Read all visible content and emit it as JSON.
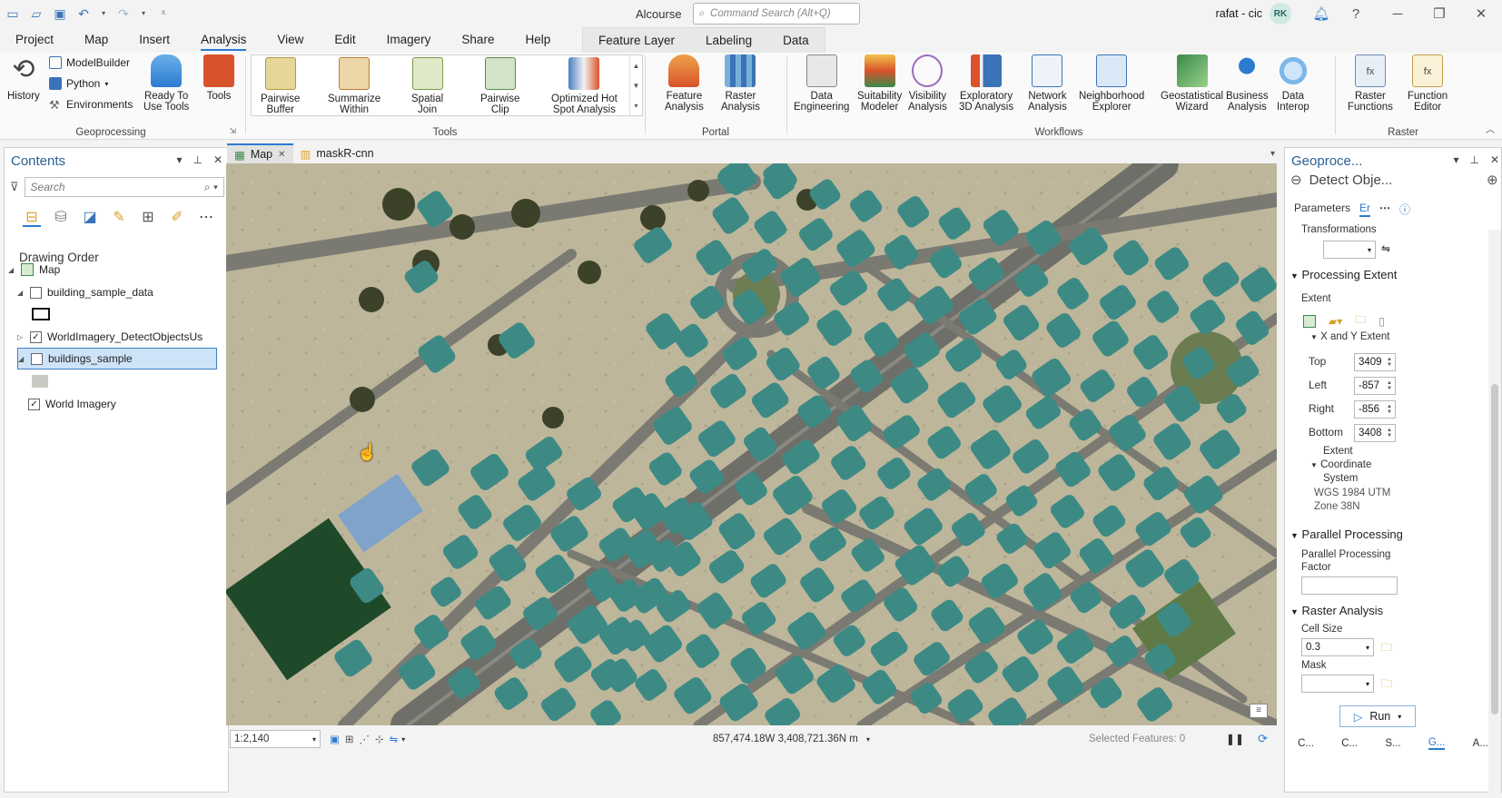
{
  "titlebar": {
    "app_title": "Alcourse",
    "search_placeholder": "Command Search (Alt+Q)",
    "user_name": "rafat - cic",
    "user_initials": "RK"
  },
  "ribbon_tabs": [
    "Project",
    "Map",
    "Insert",
    "Analysis",
    "View",
    "Edit",
    "Imagery",
    "Share",
    "Help"
  ],
  "active_tab": "Analysis",
  "context_tabs": [
    "Feature Layer",
    "Labeling",
    "Data"
  ],
  "geoprocessing_group": {
    "label": "Geoprocessing",
    "history": "History",
    "modelbuilder": "ModelBuilder",
    "python": "Python",
    "environments": "Environments",
    "ready_to_use_1": "Ready To",
    "ready_to_use_2": "Use Tools",
    "tools": "Tools"
  },
  "tools_group": {
    "label": "Tools",
    "items": [
      {
        "l1": "Pairwise",
        "l2": "Buffer"
      },
      {
        "l1": "Summarize",
        "l2": "Within"
      },
      {
        "l1": "Spatial",
        "l2": "Join"
      },
      {
        "l1": "Pairwise",
        "l2": "Clip"
      },
      {
        "l1": "Optimized Hot",
        "l2": "Spot Analysis"
      }
    ]
  },
  "portal_group": {
    "label": "Portal",
    "items": [
      {
        "l1": "Feature",
        "l2": "Analysis"
      },
      {
        "l1": "Raster",
        "l2": "Analysis"
      }
    ]
  },
  "workflows_group": {
    "label": "Workflows",
    "items": [
      {
        "l1": "Data",
        "l2": "Engineering"
      },
      {
        "l1": "Suitability",
        "l2": "Modeler"
      },
      {
        "l1": "Visibility",
        "l2": "Analysis"
      },
      {
        "l1": "Exploratory",
        "l2": "3D Analysis"
      },
      {
        "l1": "Network",
        "l2": "Analysis"
      },
      {
        "l1": "Neighborhood",
        "l2": "Explorer"
      },
      {
        "l1": "Geostatistical",
        "l2": "Wizard"
      },
      {
        "l1": "Business",
        "l2": "Analysis"
      },
      {
        "l1": "Data",
        "l2": "Interop"
      }
    ]
  },
  "raster_group": {
    "label": "Raster",
    "items": [
      {
        "l1": "Raster",
        "l2": "Functions"
      },
      {
        "l1": "Function",
        "l2": "Editor"
      }
    ]
  },
  "contents": {
    "title": "Contents",
    "search_placeholder": "Search",
    "drawing_order": "Drawing Order",
    "map_label": "Map",
    "layers": [
      {
        "name": "building_sample_data",
        "checked": false
      },
      {
        "name": "WorldImagery_DetectObjectsUs",
        "checked": true
      },
      {
        "name": "buildings_sample",
        "checked": false
      },
      {
        "name": "World Imagery",
        "checked": true
      }
    ]
  },
  "map_tabs": [
    {
      "label": "Map",
      "active": true
    },
    {
      "label": "maskR-cnn",
      "active": false
    }
  ],
  "status": {
    "scale": "1:2,140",
    "coordinates": "857,474.18W 3,408,721.36N m",
    "selected_features": "Selected Features: 0"
  },
  "geoprocessing": {
    "title": "Geoproce...",
    "tool_name": "Detect Obje...",
    "tab_parameters": "Parameters",
    "tab_env": "Er",
    "transformations": "Transformations",
    "processing_extent": "Processing Extent",
    "extent": "Extent",
    "xy_extent": "X and Y Extent",
    "top_label": "Top",
    "top_value": "3409",
    "left_label": "Left",
    "left_value": "-857",
    "right_label": "Right",
    "right_value": "-856",
    "bottom_label": "Bottom",
    "bottom_value": "3408",
    "extent_cs_1": "Extent",
    "extent_cs_2": "Coordinate",
    "extent_cs_3": "System",
    "cs_value_1": "WGS 1984 UTM",
    "cs_value_2": "Zone 38N",
    "parallel_processing": "Parallel Processing",
    "parallel_factor_1": "Parallel Processing",
    "parallel_factor_2": "Factor",
    "parallel_factor_value": "",
    "raster_analysis": "Raster Analysis",
    "cell_size": "Cell Size",
    "cell_size_value": "0.3",
    "mask": "Mask",
    "run": "Run"
  },
  "bottom_tabs": [
    "C...",
    "C...",
    "S...",
    "G...",
    "A..."
  ],
  "colors": {
    "accent": "#2b7bd0",
    "building_mask": "#3d8a84",
    "selection": "#cde3f7"
  }
}
